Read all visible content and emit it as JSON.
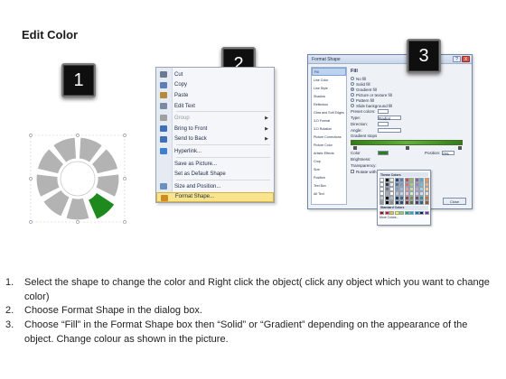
{
  "title": "Edit Color",
  "steps": {
    "one": "1",
    "two": "2",
    "three": "3"
  },
  "colors": {
    "badge_bg": "#0f0f0f",
    "gear_gray": "#b3b3b3",
    "gear_green": "#1e8a1e",
    "menu_highlight": "#f8e48c",
    "dialog_border": "#6f85a8"
  },
  "context_menu": {
    "items": [
      {
        "label": "Cut",
        "icon": "scissors-icon",
        "submenu": false,
        "disabled": false
      },
      {
        "label": "Copy",
        "icon": "copy-icon",
        "submenu": false,
        "disabled": false
      },
      {
        "label": "Paste",
        "icon": "paste-icon",
        "submenu": false,
        "disabled": false
      },
      {
        "label": "Edit Text",
        "icon": "edit-text-icon",
        "submenu": false,
        "disabled": false
      },
      {
        "label": "Group",
        "icon": "group-icon",
        "submenu": true,
        "disabled": true
      },
      {
        "label": "Bring to Front",
        "icon": "bring-front-icon",
        "submenu": true,
        "disabled": false
      },
      {
        "label": "Send to Back",
        "icon": "send-back-icon",
        "submenu": true,
        "disabled": false
      },
      {
        "label": "Hyperlink...",
        "icon": "hyperlink-icon",
        "submenu": false,
        "disabled": false
      },
      {
        "label": "Save as Picture...",
        "icon": "",
        "submenu": false,
        "disabled": false
      },
      {
        "label": "Set as Default Shape",
        "icon": "",
        "submenu": false,
        "disabled": false
      },
      {
        "label": "Size and Position...",
        "icon": "size-icon",
        "submenu": false,
        "disabled": false
      },
      {
        "label": "Format Shape...",
        "icon": "format-shape-icon",
        "submenu": false,
        "disabled": false,
        "active": true
      }
    ]
  },
  "format_dialog": {
    "title": "Format Shape",
    "help": "?",
    "close": "X",
    "nav": [
      "Fill",
      "Line Color",
      "Line Style",
      "Shadow",
      "Reflection",
      "Glow and Soft Edges",
      "3-D Format",
      "3-D Rotation",
      "Picture Corrections",
      "Picture Color",
      "Artistic Effects",
      "Crop",
      "Size",
      "Position",
      "Text Box",
      "Alt Text"
    ],
    "fill_heading": "Fill",
    "fill_options": [
      {
        "label": "No fill",
        "selected": false
      },
      {
        "label": "Solid fill",
        "selected": false
      },
      {
        "label": "Gradient fill",
        "selected": true
      },
      {
        "label": "Picture or texture fill",
        "selected": false
      },
      {
        "label": "Pattern fill",
        "selected": false
      },
      {
        "label": "Slide background fill",
        "selected": false
      }
    ],
    "preset_label": "Preset colors:",
    "type_label": "Type:",
    "type_value": "Radial",
    "direction_label": "Direction:",
    "angle_label": "Angle:",
    "gradient_stops_label": "Gradient stops",
    "color_label": "Color",
    "position_label": "Position:",
    "position_value": "0%",
    "brightness_label": "Brightness:",
    "transparency_label": "Transparency:",
    "rotate_label": "Rotate with shape",
    "theme_colors_label": "Theme Colors",
    "standard_colors_label": "Standard Colors",
    "more_colors_label": "More Colors...",
    "close_button": "Close"
  },
  "instructions": [
    {
      "num": "1.",
      "text": "Select the shape to change the color and Right click the object( click any object which you want to change color)"
    },
    {
      "num": "2.",
      "text": "Choose Format Shape in the dialog box."
    },
    {
      "num": "3.",
      "text": "Choose “Fill” in the Format Shape box then “Solid” or “Gradient” depending on the appearance of the object. Change colour as shown in the picture."
    }
  ]
}
